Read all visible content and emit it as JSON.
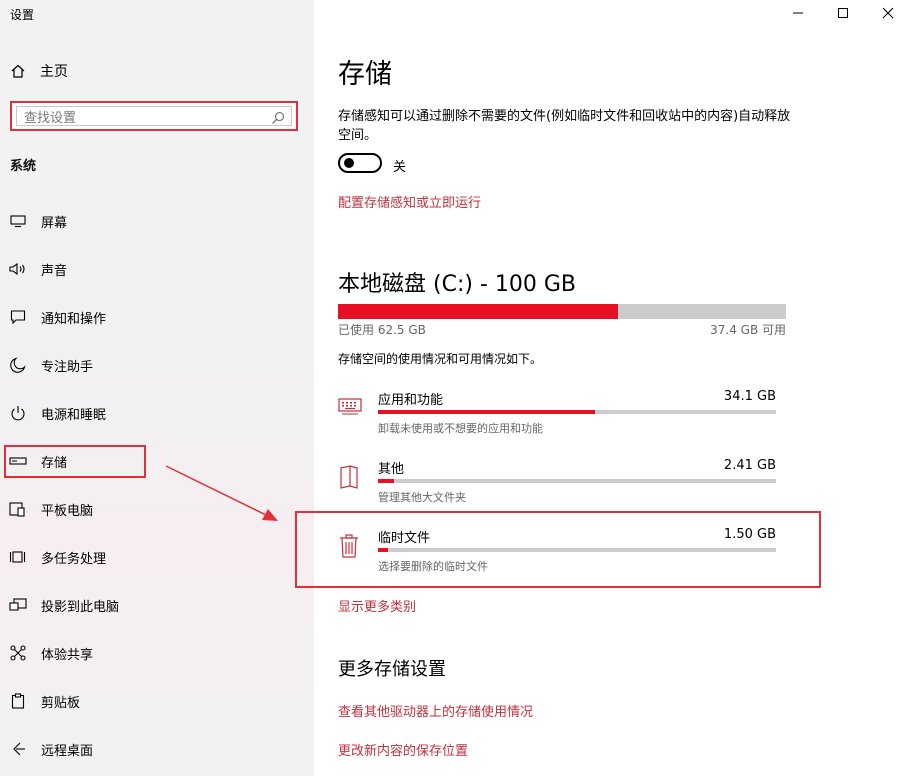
{
  "window": {
    "title": "设置",
    "controls": {
      "minimize": "minimize-icon",
      "maximize": "maximize-icon",
      "close": "close-icon"
    }
  },
  "sidebar": {
    "home_label": "主页",
    "search": {
      "placeholder": "查找设置"
    },
    "section": "系统",
    "items": [
      {
        "label": "屏幕",
        "icon": "display-icon"
      },
      {
        "label": "声音",
        "icon": "speaker-icon"
      },
      {
        "label": "通知和操作",
        "icon": "notification-icon"
      },
      {
        "label": "专注助手",
        "icon": "moon-icon"
      },
      {
        "label": "电源和睡眠",
        "icon": "power-icon"
      },
      {
        "label": "存储",
        "icon": "storage-icon",
        "selected": true
      },
      {
        "label": "平板电脑",
        "icon": "tablet-icon"
      },
      {
        "label": "多任务处理",
        "icon": "multitask-icon"
      },
      {
        "label": "投影到此电脑",
        "icon": "project-icon"
      },
      {
        "label": "体验共享",
        "icon": "share-icon"
      },
      {
        "label": "剪贴板",
        "icon": "clipboard-icon"
      },
      {
        "label": "远程桌面",
        "icon": "remote-icon"
      }
    ]
  },
  "main": {
    "title": "存储",
    "storage_sense": {
      "description": "存储感知可以通过删除不需要的文件(例如临时文件和回收站中的内容)自动释放空间。",
      "toggle_label": "关",
      "toggle_on": false,
      "configure_link": "配置存储感知或立即运行"
    },
    "disk": {
      "title": "本地磁盘 (C:) - 100 GB",
      "used_label": "已使用 62.5 GB",
      "free_label": "37.4 GB 可用",
      "used_fraction": 0.625,
      "description": "存储空间的使用情况和可用情况如下。",
      "categories": [
        {
          "name": "应用和功能",
          "size": "34.1 GB",
          "sub": "卸载未使用或不想要的应用和功能",
          "icon": "keyboard-icon",
          "fraction": 0.546
        },
        {
          "name": "其他",
          "size": "2.41 GB",
          "sub": "管理其他大文件夹",
          "icon": "book-icon",
          "fraction": 0.039
        },
        {
          "name": "临时文件",
          "size": "1.50 GB",
          "sub": "选择要删除的临时文件",
          "icon": "trash-icon",
          "fraction": 0.024
        }
      ],
      "show_more_link": "显示更多类别"
    },
    "more": {
      "title": "更多存储设置",
      "links": [
        "查看其他驱动器上的存储使用情况",
        "更改新内容的保存位置"
      ]
    }
  },
  "colors": {
    "accent": "#e81123",
    "link": "#c0303c",
    "annotation": "#e2303a"
  }
}
